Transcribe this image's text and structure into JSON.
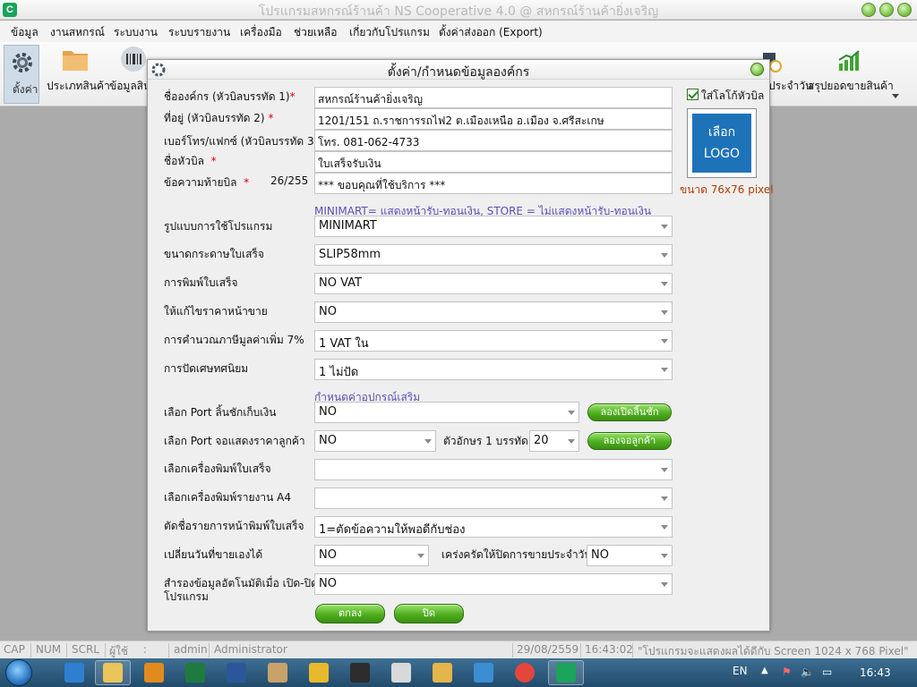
{
  "window": {
    "title": "โปรแกรมสหกรณ์ร้านค้า NS Cooperative 4.0 @ สหกรณ์ร้านค้ายิ่งเจริญ",
    "app_icon_letter": "C"
  },
  "menu": [
    "ข้อมูล",
    "งานสหกรณ์",
    "ระบบงาน",
    "ระบบรายงาน",
    "เครื่องมือ",
    "ช่วยเหลือ",
    "เกี่ยวกับโปรแกรม",
    "ตั้งค่าส่งออก (Export)"
  ],
  "toolbar": {
    "settings": "ตั้งค่า",
    "product_type": "ประเภทสินค้า",
    "product_info": "ข้อมูลสิน",
    "daily": "ประจำวัน",
    "sales_summary": "สรุปยอดขายสินค้า"
  },
  "dialog": {
    "title": "ตั้งค่า/กำหนดข้อมูลองค์กร",
    "org_name_label": "ชื่อองค์กร (หัวบิลบรรทัด 1)",
    "org_name_value": "สหกรณ์ร้านค้ายิ่งเจริญ",
    "address_label": "ที่อยู่ (หัวบิลบรรทัด 2)",
    "address_value": "1201/151 ถ.ราชการรถไฟ2 ต.เมืองเหนือ อ.เมือง จ.ศรีสะเกษ",
    "phone_label": "เบอร์โทร/แฟกซ์ (หัวบิลบรรทัด 3)",
    "phone_value": "โทร. 081-062-4733",
    "bill_title_label": "ชื่อหัวบิล",
    "bill_title_value": "ใบเสร็จรับเงิน",
    "footer_label": "ข้อความท้ายบิล",
    "footer_count": "26/255",
    "footer_value": "*** ขอบคุณที่ใช้บริการ ***",
    "required_mark": "*",
    "logo_checkbox_label": "ใส่โลโก้หัวบิล",
    "logo_button_line1": "เลือก",
    "logo_button_line2": "LOGO",
    "logo_size_note": "ขนาด 76x76 pixel",
    "mode_hint": "MINIMART= แสดงหน้ารับ-ทอนเงิน, STORE = ไม่แสดงหน้ารับ-ทอนเงิน",
    "program_mode_label": "รูปแบบการใช้โปรแกรม",
    "program_mode_value": "MINIMART",
    "paper_size_label": "ขนาดกระดาษใบเสร็จ",
    "paper_size_value": "SLIP58mm",
    "print_receipt_label": "การพิมพ์ใบเสร็จ",
    "print_receipt_value": "NO VAT",
    "edit_price_label": "ให้แก้ไขราคาหน้าขาย",
    "edit_price_value": "NO",
    "vat_calc_label": "การคำนวณภาษีมูลค่าเพิ่ม 7%",
    "vat_calc_value": "1 VAT ใน",
    "rounding_label": "การปัดเศษทศนิยม",
    "rounding_value": "1 ไม่ปัด",
    "device_hint": "กำหนดค่าอุปกรณ์เสริม",
    "cash_drawer_port_label": "เลือก Port ลิ้นชักเก็บเงิน",
    "cash_drawer_port_value": "NO",
    "test_drawer_button": "ลองเปิดลิ้นชัก",
    "customer_display_port_label": "เลือก Port จอแสดงราคาลูกค้า",
    "customer_display_port_value": "NO",
    "chars_per_line_label": "ตัวอักษร 1 บรรทัด",
    "chars_per_line_value": "20",
    "test_display_button": "ลองจอลูกค้า",
    "receipt_printer_label": "เลือกเครื่องพิมพ์ใบเสร็จ",
    "receipt_printer_value": "",
    "a4_printer_label": "เลือกเครื่องพิมพ์รายงาน A4",
    "a4_printer_value": "",
    "trim_item_name_label": "ตัดชื่อรายการหน้าพิมพ์ใบเสร็จ",
    "trim_item_name_value": "1=ตัดข้อความให้พอดีกับช่อง",
    "change_sale_date_label": "เปลี่ยนวันที่ขายเองได้",
    "change_sale_date_value": "NO",
    "force_close_label": "เคร่งครัดให้ปิดการขายประจำวัน",
    "force_close_value": "NO",
    "auto_backup_label_line1": "สำรองข้อมูลอัตโนมัติเมื่อ เปิด-ปิด",
    "auto_backup_label_line2": "โปรแกรม",
    "auto_backup_value": "NO",
    "ok_button": "ตกลง",
    "close_button": "ปิด"
  },
  "statusbar": {
    "cap": "CAP",
    "num": "NUM",
    "scrl": "SCRL",
    "user_label": "ผู้ใช้",
    "colon": ":",
    "user_id": "admin",
    "user_name": "Administrator",
    "date": "29/08/2559",
    "time": "16:43:02",
    "note": "\"โปรแกรมจะแสดงผลได้ดีกับ  Screen 1024 x 768 Pixel\""
  },
  "taskbar": {
    "lang": "EN",
    "clock": "16:43"
  },
  "colors": {
    "accent_green": "#4fae1f",
    "hint_purple": "#5b50b5",
    "logo_blue": "#1e73b8",
    "required_red": "#dd0000"
  }
}
